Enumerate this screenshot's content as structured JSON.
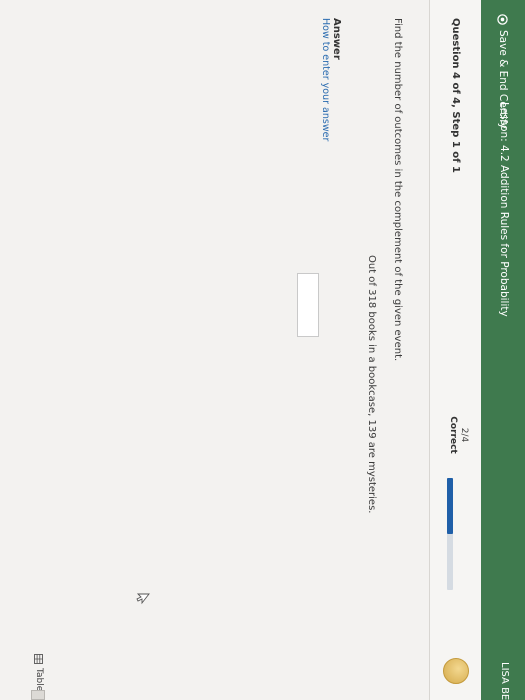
{
  "topbar": {
    "save_label": "Save & End Certify",
    "lesson": "Lesson: 4.2 Addition Rules for Probability",
    "user": "LISA BEB"
  },
  "question": {
    "title": "Question 4 of 4, Step 1 of 1",
    "score": "2/4",
    "status": "Correct",
    "progress_fraction": 0.5
  },
  "problem": {
    "instruction": "Find the number of outcomes in the complement of the given event.",
    "statement": "Out of 318 books in a bookcase, 139 are mysteries."
  },
  "answer": {
    "label": "Answer",
    "howto": "How to enter your answer",
    "value": ""
  },
  "tools": {
    "tables_label": "Tables"
  },
  "colors": {
    "topbar": "#3f7a4e",
    "progress_fill": "#1f5fa8",
    "link": "#2b6cb0"
  }
}
